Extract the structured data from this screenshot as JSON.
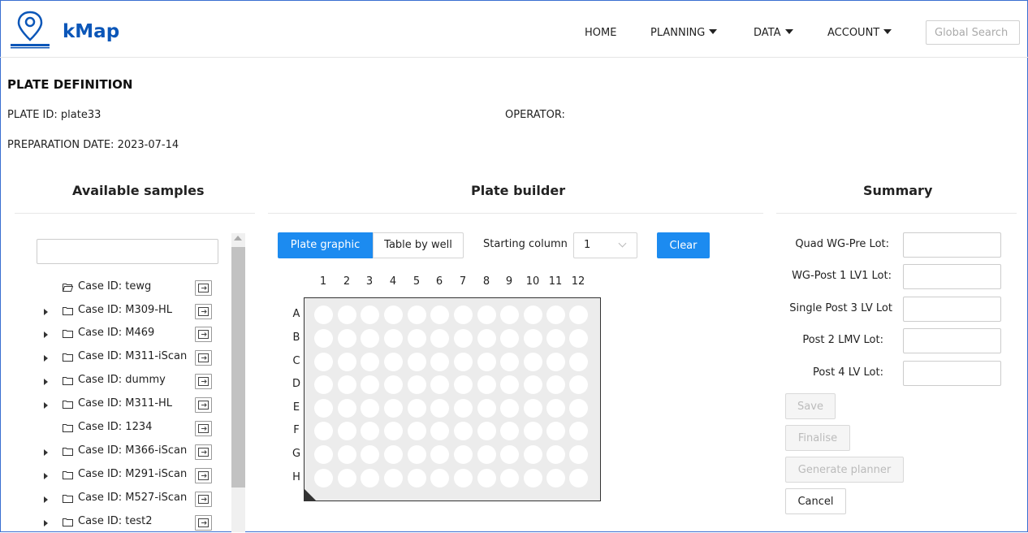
{
  "app": {
    "brand": "kMap"
  },
  "nav": {
    "home": "HOME",
    "planning": "PLANNING",
    "data": "DATA",
    "account": "ACCOUNT",
    "search_placeholder": "Global Search"
  },
  "plate": {
    "title": "PLATE DEFINITION",
    "plate_id_label": "PLATE ID:",
    "plate_id_value": "plate33",
    "operator_label": "OPERATOR:",
    "prep_date_label": "PREPARATION DATE:",
    "prep_date_value": "2023-07-14"
  },
  "samples": {
    "title": "Available samples",
    "items": [
      {
        "label": "Case ID: tewg",
        "expanded": true,
        "has_children": false
      },
      {
        "label": "Case ID: M309-HL",
        "expanded": false,
        "has_children": true
      },
      {
        "label": "Case ID: M469",
        "expanded": false,
        "has_children": true
      },
      {
        "label": "Case ID: M311-iScan",
        "expanded": false,
        "has_children": true
      },
      {
        "label": "Case ID: dummy",
        "expanded": false,
        "has_children": true
      },
      {
        "label": "Case ID: M311-HL",
        "expanded": false,
        "has_children": true
      },
      {
        "label": "Case ID: 1234",
        "expanded": false,
        "has_children": false
      },
      {
        "label": "Case ID: M366-iScan",
        "expanded": false,
        "has_children": true
      },
      {
        "label": "Case ID: M291-iScan",
        "expanded": false,
        "has_children": true
      },
      {
        "label": "Case ID: M527-iScan",
        "expanded": false,
        "has_children": true
      },
      {
        "label": "Case ID: test2",
        "expanded": false,
        "has_children": true
      }
    ]
  },
  "builder": {
    "title": "Plate builder",
    "tab_graphic": "Plate graphic",
    "tab_table": "Table by well",
    "starting_column_label": "Starting column",
    "starting_column_value": "1",
    "clear": "Clear",
    "columns": [
      "1",
      "2",
      "3",
      "4",
      "5",
      "6",
      "7",
      "8",
      "9",
      "10",
      "11",
      "12"
    ],
    "rows": [
      "A",
      "B",
      "C",
      "D",
      "E",
      "F",
      "G",
      "H"
    ]
  },
  "summary": {
    "title": "Summary",
    "fields": [
      "Quad WG-Pre Lot:",
      "WG-Post 1 LV1 Lot:",
      "Single Post 3 LV Lot",
      "Post 2 LMV Lot:",
      "Post 4 LV Lot:"
    ],
    "save": "Save",
    "finalise": "Finalise",
    "generate": "Generate planner",
    "cancel": "Cancel"
  },
  "colors": {
    "brand": "#0b56b8",
    "accent": "#1c8bf0",
    "plate_bg": "#ececec"
  }
}
